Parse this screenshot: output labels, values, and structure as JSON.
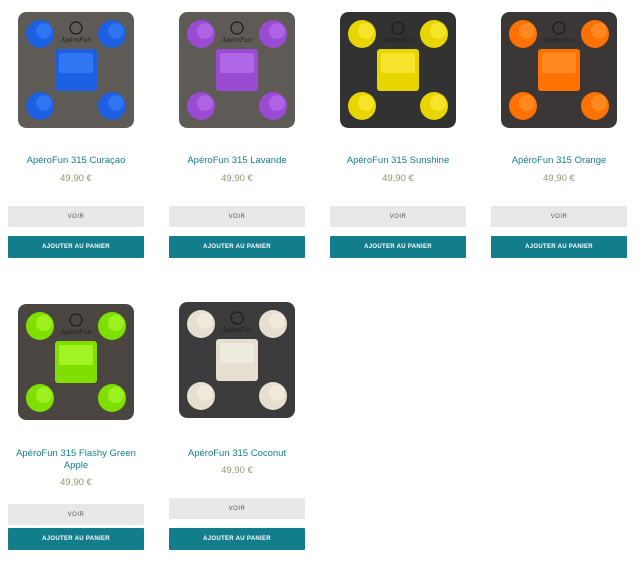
{
  "products": [
    {
      "name": "ApéroFun 315 Curaçao",
      "price": "49,90 €",
      "view_label": "VOIR",
      "cart_label": "AJOUTER AU PANIER",
      "board_color": "#5e5a56",
      "accent": "#1c5fe0",
      "accent_light": "#3f87ff"
    },
    {
      "name": "ApéroFun 315 Lavande",
      "price": "49,90 €",
      "view_label": "VOIR",
      "cart_label": "AJOUTER AU PANIER",
      "board_color": "#5e5a56",
      "accent": "#9a4bd4",
      "accent_light": "#bd79f0"
    },
    {
      "name": "ApéroFun 315 Sunshine",
      "price": "49,90 €",
      "view_label": "VOIR",
      "cart_label": "AJOUTER AU PANIER",
      "board_color": "#323232",
      "accent": "#e8d500",
      "accent_light": "#fff04a"
    },
    {
      "name": "ApéroFun 315 Orange",
      "price": "49,90 €",
      "view_label": "VOIR",
      "cart_label": "AJOUTER AU PANIER",
      "board_color": "#3a3736",
      "accent": "#ff7200",
      "accent_light": "#ff9a3a"
    },
    {
      "name": "ApéroFun 315 Flashy Green Apple",
      "price": "49,90 €",
      "view_label": "VOIR",
      "cart_label": "AJOUTER AU PANIER",
      "board_color": "#4b4542",
      "accent": "#7fe000",
      "accent_light": "#b8ff3a"
    },
    {
      "name": "ApéroFun 315 Coconut",
      "price": "49,90 €",
      "view_label": "VOIR",
      "cart_label": "AJOUTER AU PANIER",
      "board_color": "#3c3b3b",
      "accent": "#e6dfcf",
      "accent_light": "#f7f3ea"
    }
  ],
  "brand_logo_text": "ApéroFun"
}
